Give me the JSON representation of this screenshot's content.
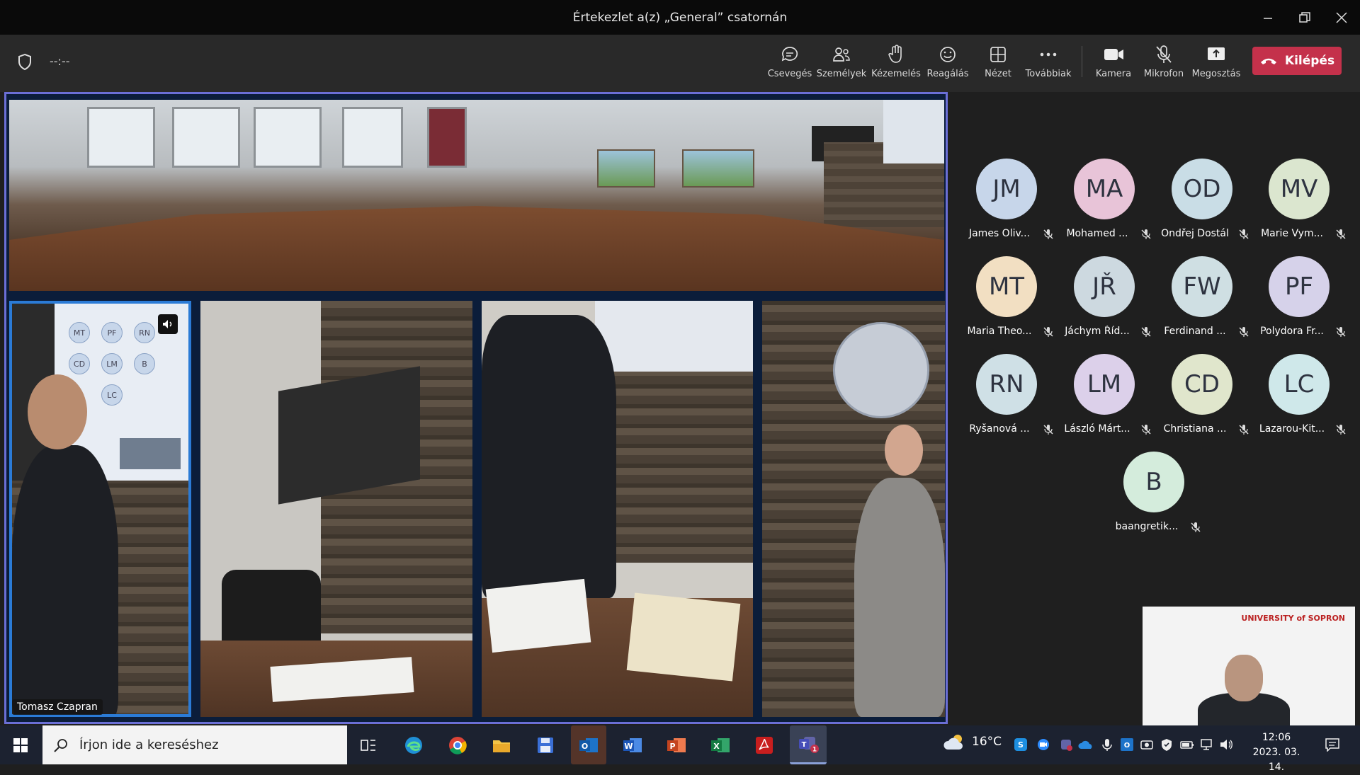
{
  "window": {
    "title": "Értekezlet a(z) „General” csatornán",
    "controls": [
      "minimize",
      "restore",
      "close"
    ]
  },
  "toolbar": {
    "timer": "--:--",
    "buttons": [
      {
        "label": "Csevegés",
        "icon": "chat-icon"
      },
      {
        "label": "Személyek",
        "icon": "people-icon"
      },
      {
        "label": "Kézemelés",
        "icon": "raise-hand-icon"
      },
      {
        "label": "Reagálás",
        "icon": "smiley-icon"
      },
      {
        "label": "Nézet",
        "icon": "view-grid-icon"
      },
      {
        "label": "Továbbiak",
        "icon": "more-icon"
      },
      {
        "label": "Kamera",
        "icon": "camera-icon"
      },
      {
        "label": "Mikrofon",
        "icon": "mic-off-icon"
      },
      {
        "label": "Megosztás",
        "icon": "share-icon"
      }
    ],
    "leave_label": "Kilépés",
    "leave_color": "#c4314b"
  },
  "stage": {
    "speaker_name": "Tomasz Czapran",
    "active_border_color": "#2b7bd6",
    "frame_color": "#6b6fd6",
    "mini_avatars": [
      "MT",
      "PF",
      "RN",
      "CD",
      "LM",
      "B",
      "LC"
    ]
  },
  "participants": [
    {
      "initials": "JM",
      "name": "James Oliv...",
      "color": "#c7d6ea"
    },
    {
      "initials": "MA",
      "name": "Mohamed ...",
      "color": "#e8c4d8"
    },
    {
      "initials": "OD",
      "name": "Ondřej Dostál",
      "color": "#c9dde6"
    },
    {
      "initials": "MV",
      "name": "Marie Vym...",
      "color": "#dbe6cf"
    },
    {
      "initials": "MT",
      "name": "Maria Theo...",
      "color": "#f2dfc2"
    },
    {
      "initials": "JŘ",
      "name": "Jáchym Říd...",
      "color": "#cdd9e0"
    },
    {
      "initials": "FW",
      "name": "Ferdinand ...",
      "color": "#cfdfe3"
    },
    {
      "initials": "PF",
      "name": "Polydora Fr...",
      "color": "#d6d2ea"
    },
    {
      "initials": "RN",
      "name": "Ryšanová ...",
      "color": "#cfe0e6"
    },
    {
      "initials": "LM",
      "name": "László Márt...",
      "color": "#dcd0ea"
    },
    {
      "initials": "CD",
      "name": "Christiana ...",
      "color": "#e0e6cc"
    },
    {
      "initials": "LC",
      "name": "Lazarou-Kit...",
      "color": "#cfe8ea"
    },
    {
      "initials": "B",
      "name": "baangretik...",
      "color": "#d4ecdc"
    }
  ],
  "selfview": {
    "logo_text": "UNIVERSITY of SOPRON"
  },
  "taskbar": {
    "search_placeholder": "Írjon ide a kereséshez",
    "apps": [
      "task-view",
      "edge",
      "chrome",
      "file-explorer",
      "save-app",
      "outlook",
      "word",
      "powerpoint",
      "excel",
      "acrobat",
      "teams"
    ],
    "teams_badge": "1",
    "weather_temp": "16°C",
    "time": "12:06",
    "date": "2023. 03. 14."
  }
}
